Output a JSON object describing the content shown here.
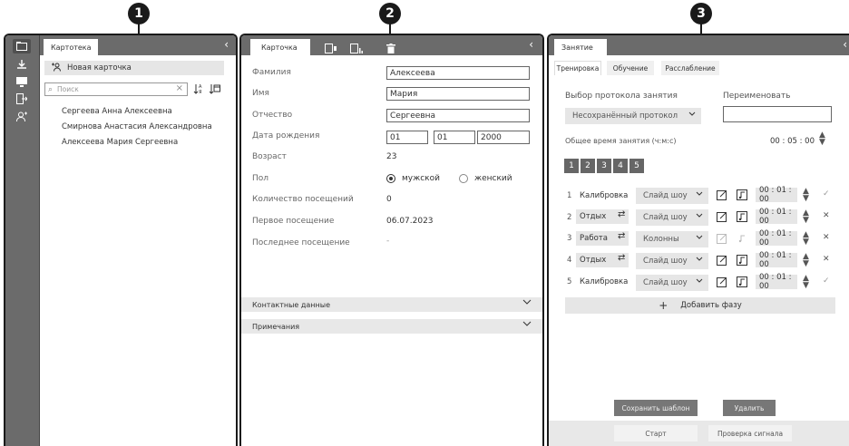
{
  "callouts": [
    "1",
    "2",
    "3"
  ],
  "icons": {
    "toolbar": [
      "folder-icon",
      "download-icon",
      "monitor-icon",
      "export-icon",
      "add-user-icon"
    ],
    "chevron_left": "‹",
    "chevron_down": "⌄"
  },
  "panel1": {
    "tab": "Картотека",
    "new_card": "Новая карточка",
    "search_placeholder": "Поиск",
    "people": [
      "Сергеева Анна Алексеевна",
      "Смирнова Анастасия Александровна",
      "Алексеева Мария Сергеевна"
    ]
  },
  "panel2": {
    "tab": "Карточка",
    "fields": {
      "surname_label": "Фамилия",
      "surname": "Алексеева",
      "name_label": "Имя",
      "name": "Мария",
      "patronymic_label": "Отчество",
      "patronymic": "Сергеевна",
      "dob_label": "Дата рождения",
      "dob_day": "01",
      "dob_month": "01",
      "dob_year": "2000",
      "age_label": "Возраст",
      "age": "23",
      "sex_label": "Пол",
      "male": "мужской",
      "female": "женский",
      "visits_label": "Количество посещений",
      "visits": "0",
      "first_visit_label": "Первое посещение",
      "first_visit": "06.07.2023",
      "last_visit_label": "Последнее посещение",
      "last_visit": "-"
    },
    "section_contacts": "Контактные данные",
    "section_notes": "Примечания"
  },
  "panel3": {
    "tab": "Занятие",
    "subtabs": [
      "Тренировка",
      "Обучение",
      "Расслабление"
    ],
    "protocol_label": "Выбор протокола занятия",
    "rename_label": "Переименовать",
    "protocol_value": "Несохранённый протокол",
    "total_time_label": "Общее время занятия (ч:м:с)",
    "total_time": "00 : 05 : 00",
    "numbers": [
      "1",
      "2",
      "3",
      "4",
      "5"
    ],
    "phases": [
      {
        "idx": "1",
        "name": "Калибровка",
        "mode": "Слайд шоу",
        "time": "00 : 01 : 00",
        "end": "✓"
      },
      {
        "idx": "2",
        "name": "Отдых",
        "mode": "Слайд шоу",
        "time": "00 : 01 : 00",
        "end": "✕"
      },
      {
        "idx": "3",
        "name": "Работа",
        "mode": "Колонны",
        "time": "00 : 01 : 00",
        "end": "✕"
      },
      {
        "idx": "4",
        "name": "Отдых",
        "mode": "Слайд шоу",
        "time": "00 : 01 : 00",
        "end": "✕"
      },
      {
        "idx": "5",
        "name": "Калибровка",
        "mode": "Слайд шоу",
        "time": "00 : 01 : 00",
        "end": "✓"
      }
    ],
    "add_phase": "Добавить фазу",
    "save_template": "Сохранить шаблон",
    "delete": "Удалить",
    "start": "Старт",
    "check_signal": "Проверка сигнала"
  }
}
